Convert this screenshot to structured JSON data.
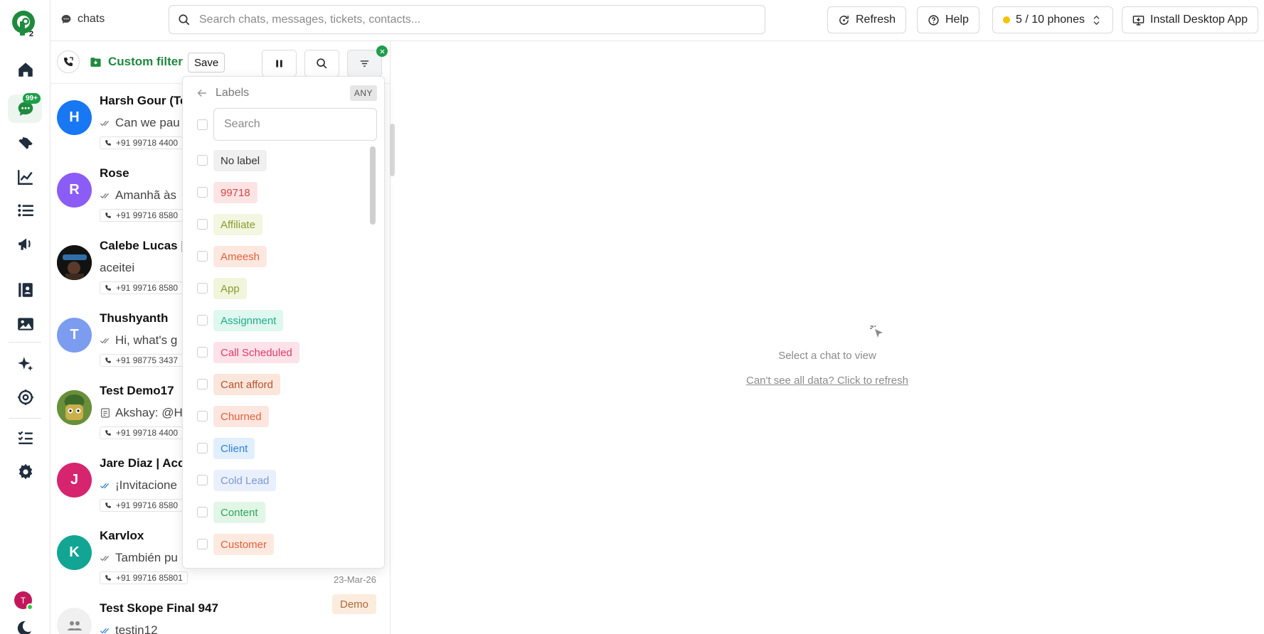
{
  "app": {
    "logo_text": "P2"
  },
  "rail": {
    "chats_badge": "99+",
    "user_initial": "T"
  },
  "topbar": {
    "breadcrumb": "chats",
    "search_placeholder": "Search chats, messages, tickets, contacts...",
    "refresh_label": "Refresh",
    "help_label": "Help",
    "phones_label": "5 / 10 phones",
    "install_label": "Install Desktop App"
  },
  "list_toolbar": {
    "filter_name": "Custom filter",
    "save_label": "Save"
  },
  "chats": [
    {
      "name": "Harsh Gour (Te",
      "message": "Can we pau",
      "phone": "+91 99718 4400",
      "avatar_letter": "H",
      "avatar_color": "#1877f2",
      "check": "read-grey"
    },
    {
      "name": "Rose",
      "message": "Amanhã às",
      "phone": "+91 99716 8580",
      "avatar_letter": "R",
      "avatar_color": "#8b5cf6",
      "check": "read-grey"
    },
    {
      "name": "Calebe Lucas |",
      "message": "aceitei",
      "phone": "+91 99716 8580",
      "avatar_letter": "",
      "avatar_color": "#1b1b1b",
      "check": "none"
    },
    {
      "name": "Thushyanth",
      "message": "Hi, what's g",
      "phone": "+91 98775 3437",
      "avatar_letter": "T",
      "avatar_color": "#7c9cf0",
      "check": "read-grey"
    },
    {
      "name": "Test Demo17",
      "message": "Akshay: @H",
      "phone": "+91 99718 4400",
      "avatar_letter": "",
      "avatar_color": "#4a7b2c",
      "check": "note"
    },
    {
      "name": "Jare Diaz | Acc",
      "message": "¡Invitacione",
      "phone": "+91 99716 8580",
      "avatar_letter": "J",
      "avatar_color": "#d6246e",
      "check": "read-blue"
    },
    {
      "name": "Karvlox",
      "message": "También pu",
      "phone": "+91 99716 85801",
      "avatar_letter": "K",
      "avatar_color": "#12a594",
      "check": "read-grey",
      "date": "23-Mar-26"
    },
    {
      "name": "Test Skope Final 947",
      "message": "testin12",
      "phone": "",
      "avatar_letter": "",
      "avatar_color": "#f0f0f0",
      "check": "read-blue",
      "tag": "Demo"
    }
  ],
  "label_menu": {
    "title": "Labels",
    "mode": "ANY",
    "search_placeholder": "Search",
    "labels": [
      {
        "name": "No label",
        "bg": "#f0f0f0",
        "fg": "#333333"
      },
      {
        "name": "99718",
        "bg": "#fde4e4",
        "fg": "#d64545"
      },
      {
        "name": "Affiliate",
        "bg": "#f3f6e0",
        "fg": "#8a9a2e"
      },
      {
        "name": "Ameesh",
        "bg": "#fde8e0",
        "fg": "#e0603a"
      },
      {
        "name": "App",
        "bg": "#f1f5dc",
        "fg": "#8a9a2e"
      },
      {
        "name": "Assignment",
        "bg": "#def7ef",
        "fg": "#1fae82"
      },
      {
        "name": "Call Scheduled",
        "bg": "#fde2ea",
        "fg": "#df3a6a"
      },
      {
        "name": "Cant afford",
        "bg": "#fbe6dc",
        "fg": "#b5542e"
      },
      {
        "name": "Churned",
        "bg": "#fde6df",
        "fg": "#e0603a"
      },
      {
        "name": "Client",
        "bg": "#e1effd",
        "fg": "#2f7fd6"
      },
      {
        "name": "Cold Lead",
        "bg": "#eaf0fb",
        "fg": "#7a99d6"
      },
      {
        "name": "Content",
        "bg": "#e1f6e6",
        "fg": "#2fa55a"
      },
      {
        "name": "Customer",
        "bg": "#fde9df",
        "fg": "#e0603a"
      }
    ]
  },
  "empty_state": {
    "title": "Select a chat to view",
    "refresh_link": "Can't see all data? Click to refresh"
  },
  "colors": {
    "brand": "#1e8a3e",
    "accent_badge": "#1e9e4a"
  }
}
